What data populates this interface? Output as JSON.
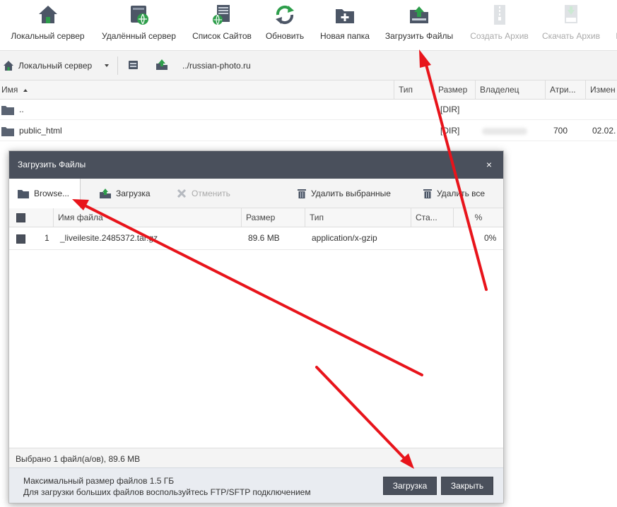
{
  "toolbar": {
    "items": [
      {
        "label": "Локальный сервер",
        "icon": "home-server-icon",
        "disabled": false
      },
      {
        "label": "Удалённый сервер",
        "icon": "remote-server-icon",
        "disabled": false
      },
      {
        "label": "Список Сайтов",
        "icon": "site-list-icon",
        "disabled": false
      },
      {
        "label": "Обновить",
        "icon": "refresh-icon",
        "disabled": false
      },
      {
        "label": "Новая папка",
        "icon": "new-folder-icon",
        "disabled": false
      },
      {
        "label": "Загрузить Файлы",
        "icon": "upload-files-icon",
        "disabled": false
      },
      {
        "label": "Создать Архив",
        "icon": "create-archive-icon",
        "disabled": true
      },
      {
        "label": "Скачать Архив",
        "icon": "download-archive-icon",
        "disabled": true
      },
      {
        "label": "П",
        "icon": "",
        "disabled": false
      }
    ]
  },
  "pathbar": {
    "server_label": "Локальный сервер",
    "path": "../russian-photo.ru"
  },
  "file_grid": {
    "columns": [
      "Имя",
      "Тип",
      "Размер",
      "Владелец",
      "Атри...",
      "Измен"
    ],
    "rows": [
      {
        "name": "..",
        "type": "",
        "size": "[DIR]",
        "owner": "",
        "attrs": "",
        "modified": ""
      },
      {
        "name": "public_html",
        "type": "",
        "size": "[DIR]",
        "owner": "",
        "attrs": "700",
        "modified": "02.02."
      }
    ]
  },
  "dialog": {
    "title": "Загрузить Файлы",
    "close": "×",
    "tools": {
      "browse": "Browse...",
      "upload": "Загрузка",
      "cancel": "Отменить",
      "delete_selected": "Удалить выбранные",
      "delete_all": "Удалить все"
    },
    "columns": [
      "Имя файла",
      "Размер",
      "Тип",
      "Ста...",
      "%"
    ],
    "files": [
      {
        "num": "1",
        "name": "_liveilesite.2485372.tar.gz",
        "size": "89.6 MB",
        "type": "application/x-gzip",
        "status": "",
        "percent": "0%"
      }
    ],
    "status": "Выбрано 1 файл(а/ов), 89.6 MB",
    "info_line1": "Максимальный размер файлов 1.5 ГБ",
    "info_line2": "Для загрузки больших файлов воспользуйтесь FTP/SFTP подключением",
    "upload_button": "Загрузка",
    "close_button": "Закрыть"
  },
  "colors": {
    "dialog_header": "#4a505c",
    "annotation_arrow": "#e8141b",
    "icon_green": "#2e9e4b",
    "icon_slate": "#4c5666"
  }
}
